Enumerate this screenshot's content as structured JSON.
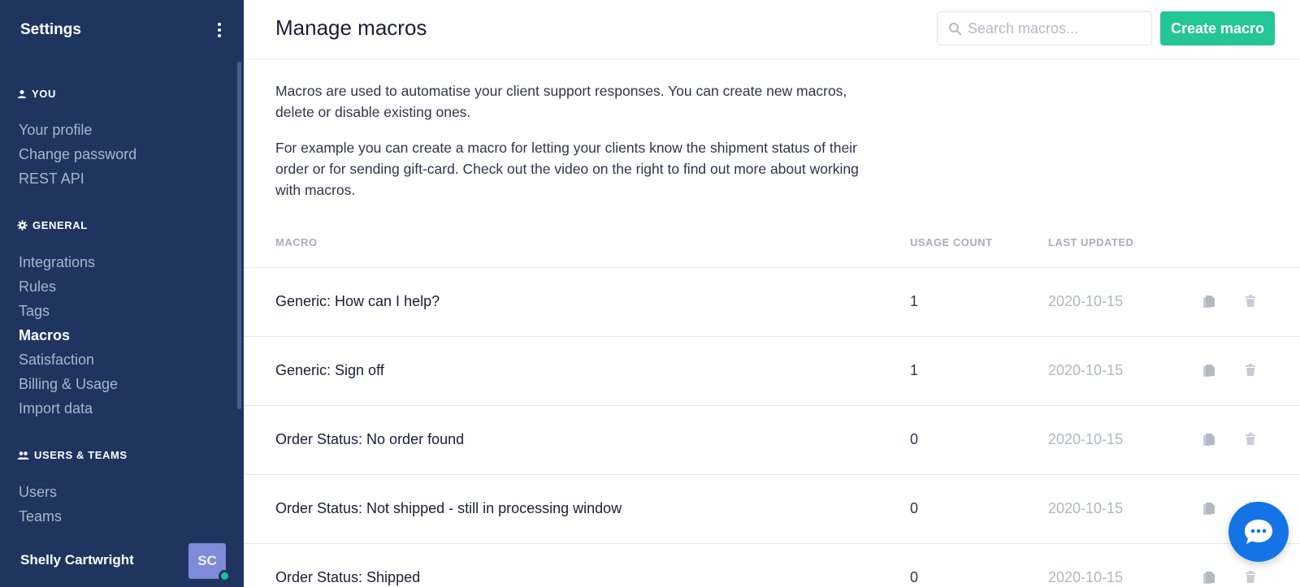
{
  "sidebar": {
    "title": "Settings",
    "sections": [
      {
        "label": "YOU",
        "icon": "person-icon",
        "items": [
          "Your profile",
          "Change password",
          "REST API"
        ]
      },
      {
        "label": "GENERAL",
        "icon": "gear-icon",
        "items": [
          "Integrations",
          "Rules",
          "Tags",
          "Macros",
          "Satisfaction",
          "Billing & Usage",
          "Import data"
        ]
      },
      {
        "label": "USERS & TEAMS",
        "icon": "people-icon",
        "items": [
          "Users",
          "Teams"
        ]
      }
    ],
    "active_item": "Macros",
    "user": {
      "name": "Shelly Cartwright",
      "initials": "SC",
      "status": "online"
    }
  },
  "header": {
    "title": "Manage macros",
    "search_placeholder": "Search macros...",
    "create_label": "Create macro"
  },
  "description": {
    "p1": "Macros are used to automatise your client support responses. You can create new macros, delete or disable existing ones.",
    "p2": "For example you can create a macro for letting your clients know the shipment status of their order or for sending gift-card. Check out the video on the right to find out more about working with macros."
  },
  "table": {
    "columns": [
      "MACRO",
      "USAGE COUNT",
      "LAST UPDATED"
    ],
    "rows": [
      {
        "name": "Generic: How can I help?",
        "usage": "1",
        "updated": "2020-10-15"
      },
      {
        "name": "Generic: Sign off",
        "usage": "1",
        "updated": "2020-10-15"
      },
      {
        "name": "Order Status: No order found",
        "usage": "0",
        "updated": "2020-10-15"
      },
      {
        "name": "Order Status: Not shipped - still in processing window",
        "usage": "0",
        "updated": "2020-10-15"
      },
      {
        "name": "Order Status: Shipped",
        "usage": "0",
        "updated": "2020-10-15"
      }
    ]
  },
  "colors": {
    "sidebar_bg": "#1f3560",
    "accent_green": "#24c596",
    "chat_blue": "#1474e6"
  }
}
